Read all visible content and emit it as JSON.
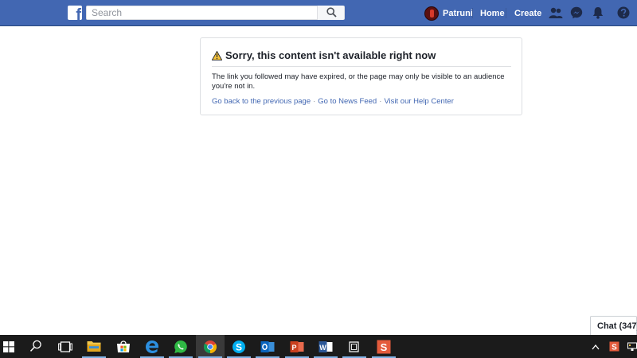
{
  "topbar": {
    "logo_letter": "f",
    "search_placeholder": "Search",
    "profile_name": "Patruni",
    "home_label": "Home",
    "create_label": "Create"
  },
  "error_card": {
    "title": "Sorry, this content isn't available right now",
    "message": "The link you followed may have expired, or the page may only be visible to an audience you're not in.",
    "links": [
      "Go back to the previous page",
      "Go to News Feed",
      "Visit our Help Center"
    ],
    "separator": "·"
  },
  "chat": {
    "label": "Chat (347)"
  },
  "taskbar": {
    "items": [
      "windows-start-icon",
      "cortana-search-icon",
      "task-view-icon",
      "file-explorer-icon",
      "store-icon",
      "edge-icon",
      "whatsapp-icon",
      "chrome-icon",
      "skype-icon",
      "outlook-icon",
      "powerpoint-icon",
      "word-icon",
      "generic-app-icon",
      "sublime-icon"
    ],
    "tray": [
      "show-hidden-icons-icon",
      "tray-app-icon",
      "network-icon"
    ]
  },
  "colors": {
    "brand": "#4267b2",
    "link": "#4267b2",
    "text": "#1d2129",
    "warning": "#f5c33b",
    "taskbar": "#1b1b1b"
  }
}
